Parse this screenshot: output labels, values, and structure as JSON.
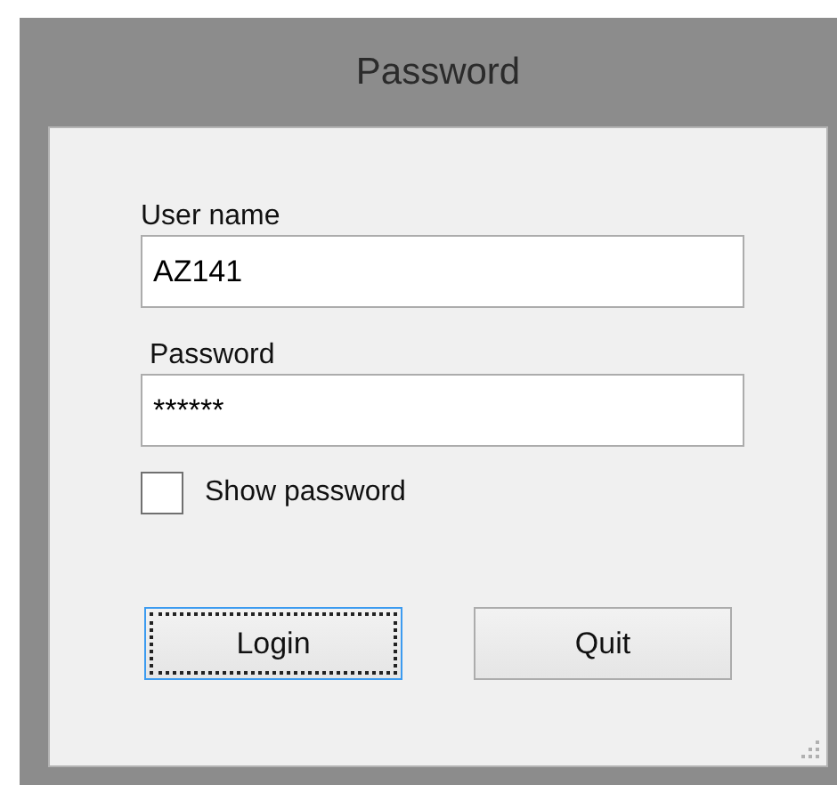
{
  "window": {
    "title": "Password"
  },
  "fields": [
    {
      "label": "User name",
      "value": "AZ141"
    },
    {
      "label": "Password",
      "value": "******"
    }
  ],
  "show_password": {
    "label": "Show password",
    "checked": false
  },
  "buttons": [
    {
      "label": "Login",
      "focused": true
    },
    {
      "label": "Quit",
      "focused": false
    }
  ]
}
